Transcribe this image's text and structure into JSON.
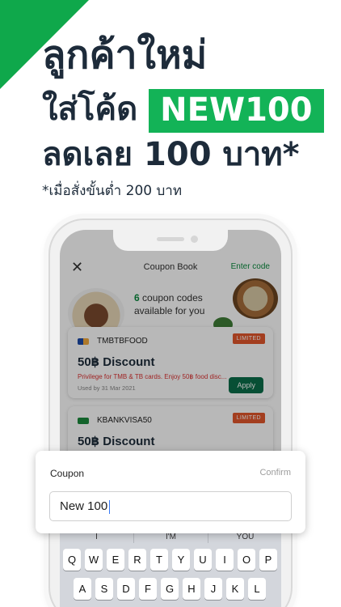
{
  "promo": {
    "headline_1": "ลูกค้าใหม่",
    "headline_2_prefix": "ใส่โค้ด",
    "promo_code": "NEW100",
    "headline_3": "ลดเลย 100 บาท*",
    "footnote": "*เมื่อสั่งขั้นต่ำ 200 บาท",
    "accent_color": "#13b357"
  },
  "app": {
    "close_icon": "close-icon",
    "title": "Coupon Book",
    "enter_code": "Enter code",
    "count": "6",
    "count_text_1": "coupon codes",
    "count_text_2": "available for you"
  },
  "coupons": [
    {
      "code": "TMBTBFOOD",
      "badge": "LIMITED",
      "discount": "50฿ Discount",
      "privilege": "Privilege for TMB & TB cards. Enjoy 50฿ food disc...",
      "used_by": "Used by 31 Mar 2021",
      "apply": "Apply"
    },
    {
      "code": "KBANKVISA50",
      "badge": "LIMITED",
      "discount": "50฿ Discount"
    }
  ],
  "dialog": {
    "label": "Coupon",
    "confirm": "Confirm",
    "input_value": "New 100"
  },
  "keyboard": {
    "suggestions": [
      "I",
      "I'M",
      "YOU"
    ],
    "row1": [
      "Q",
      "W",
      "E",
      "R",
      "T",
      "Y",
      "U",
      "I",
      "O",
      "P"
    ],
    "row2": [
      "A",
      "S",
      "D",
      "F",
      "G",
      "H",
      "J",
      "K",
      "L"
    ]
  }
}
